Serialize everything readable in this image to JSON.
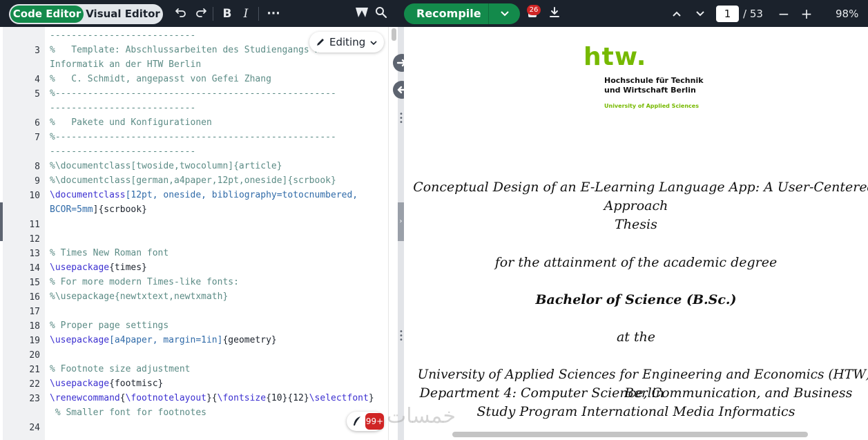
{
  "toolbar": {
    "code_editor_label": "Code Editor",
    "visual_editor_label": "Visual Editor",
    "recompile_label": "Recompile",
    "logs_count": "26",
    "current_page": "1",
    "total_pages": "/ 53",
    "zoom": "98%"
  },
  "editor": {
    "mode_label": "Editing",
    "lines": [
      {
        "num": "",
        "segs": [
          {
            "t": "---------------------------",
            "c": "cmt"
          }
        ]
      },
      {
        "num": "3",
        "segs": [
          {
            "t": "%   Template: Abschlussarbeiten des Studiengangs Wi-",
            "c": "cmt"
          }
        ]
      },
      {
        "num": "",
        "segs": [
          {
            "t": "Informatik an der HTW Berlin",
            "c": "cmt"
          }
        ]
      },
      {
        "num": "4",
        "segs": [
          {
            "t": "%   C. Schmidt, angepasst von Gefei Zhang",
            "c": "cmt"
          }
        ]
      },
      {
        "num": "5",
        "segs": [
          {
            "t": "%----------------------------------------------------",
            "c": "cmt"
          }
        ]
      },
      {
        "num": "",
        "segs": [
          {
            "t": "---------------------------",
            "c": "cmt"
          }
        ]
      },
      {
        "num": "6",
        "segs": [
          {
            "t": "%   Pakete und Konfigurationen",
            "c": "cmt"
          }
        ]
      },
      {
        "num": "7",
        "segs": [
          {
            "t": "%----------------------------------------------------",
            "c": "cmt"
          }
        ]
      },
      {
        "num": "",
        "segs": [
          {
            "t": "---------------------------",
            "c": "cmt"
          }
        ]
      },
      {
        "num": "8",
        "segs": [
          {
            "t": "%\\documentclass[twoside,twocolumn]{article}",
            "c": "cmt"
          }
        ]
      },
      {
        "num": "9",
        "segs": [
          {
            "t": "%\\documentclass[german,a4paper,12pt,oneside]{scrbook}",
            "c": "cmt"
          }
        ]
      },
      {
        "num": "10",
        "segs": [
          {
            "t": "\\documentclass",
            "c": "cmd"
          },
          {
            "t": "[12pt, oneside, bibliography=totocnumbered,",
            "c": "arg"
          }
        ]
      },
      {
        "num": "",
        "segs": [
          {
            "t": "BCOR=5mm",
            "c": "arg"
          },
          {
            "t": "]{scrbook}",
            "c": "txt"
          }
        ]
      },
      {
        "num": "11",
        "segs": []
      },
      {
        "num": "12",
        "segs": []
      },
      {
        "num": "13",
        "segs": [
          {
            "t": "% Times New Roman font",
            "c": "cmt"
          }
        ]
      },
      {
        "num": "14",
        "segs": [
          {
            "t": "\\usepackage",
            "c": "cmd"
          },
          {
            "t": "{times}",
            "c": "txt"
          }
        ]
      },
      {
        "num": "15",
        "segs": [
          {
            "t": "% For more modern Times-like fonts:",
            "c": "cmt"
          }
        ]
      },
      {
        "num": "16",
        "segs": [
          {
            "t": "%\\usepackage{newtxtext,newtxmath}",
            "c": "cmt"
          }
        ]
      },
      {
        "num": "17",
        "segs": []
      },
      {
        "num": "18",
        "segs": [
          {
            "t": "% Proper page settings",
            "c": "cmt"
          }
        ]
      },
      {
        "num": "19",
        "segs": [
          {
            "t": "\\usepackage",
            "c": "cmd"
          },
          {
            "t": "[a4paper, margin=1in]",
            "c": "arg"
          },
          {
            "t": "{geometry}",
            "c": "txt"
          }
        ]
      },
      {
        "num": "20",
        "segs": []
      },
      {
        "num": "21",
        "segs": [
          {
            "t": "% Footnote size adjustment",
            "c": "cmt"
          }
        ]
      },
      {
        "num": "22",
        "segs": [
          {
            "t": "\\usepackage",
            "c": "cmd"
          },
          {
            "t": "{footmisc}",
            "c": "txt"
          }
        ]
      },
      {
        "num": "23",
        "segs": [
          {
            "t": "\\renewcommand",
            "c": "cmd"
          },
          {
            "t": "{",
            "c": "txt"
          },
          {
            "t": "\\footnotelayout",
            "c": "cmd"
          },
          {
            "t": "}{",
            "c": "txt"
          },
          {
            "t": "\\fontsize",
            "c": "cmd"
          },
          {
            "t": "{10}{12}",
            "c": "txt"
          },
          {
            "t": "\\selectfont",
            "c": "cmd"
          },
          {
            "t": "}",
            "c": "txt"
          }
        ]
      },
      {
        "num": "",
        "segs": [
          {
            "t": " % Smaller font for footnotes",
            "c": "cmt"
          }
        ]
      },
      {
        "num": "24",
        "segs": []
      }
    ],
    "ai_badge": "99+"
  },
  "pdf": {
    "logo_word": "htw.",
    "logo_line1": "Hochschule für Technik",
    "logo_line2": "und Wirtschaft Berlin",
    "logo_line3": "University of Applied Sciences",
    "title_line1": "Conceptual Design of an E-Learning Language App: A User-Centered",
    "title_line2": "Approach",
    "title_line3": "Thesis",
    "attain": "for the attainment of the academic degree",
    "degree": "Bachelor of Science (B.Sc.)",
    "at_the": "at the",
    "uni": "University of Applied Sciences for Engineering and Economics (HTW) Berlin",
    "dept": "Department 4: Computer Science, Communication, and Business",
    "program": "Study Program International Media Informatics"
  },
  "watermark": "خمسات",
  "colors": {
    "accent": "#138a4b",
    "logo_green": "#76b900",
    "topbar": "#1b222c"
  }
}
